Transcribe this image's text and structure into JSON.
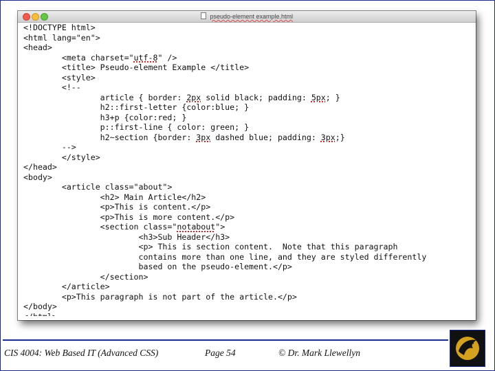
{
  "window": {
    "title": "pseudo-element example.html"
  },
  "code_lines": [
    "<!DOCTYPE html>",
    "<html lang=\"en\">",
    "<head>",
    "        <meta charset=\"utf-8\" />",
    "        <title> Pseudo-element Example </title>",
    "        <style>",
    "        <!--",
    "                article { border: 2px solid black; padding: 5px; }",
    "                h2::first-letter {color:blue; }",
    "                h3+p {color:red; }",
    "                p::first-line { color: green; }",
    "                h2~section {border: 3px dashed blue; padding: 3px;}",
    "        -->",
    "        </style>",
    "</head>",
    "<body>",
    "        <article class=\"about\">",
    "                <h2> Main Article</h2>",
    "                <p>This is content.</p>",
    "                <p>This is more content.</p>",
    "                <section class=\"notabout\">",
    "                        <h3>Sub Header</h3>",
    "                        <p> This is section content.  Note that this paragraph",
    "                        contains more than one line, and they are styled differently",
    "                        based on the pseudo-element.</p>",
    "                </section>",
    "        </article>",
    "        <p>This paragraph is not part of the article.</p>",
    "</body>",
    "</html>"
  ],
  "footer": {
    "course": "CIS 4004: Web Based IT (Advanced CSS)",
    "page": "Page 54",
    "author": "© Dr. Mark Llewellyn"
  },
  "colors": {
    "accent": "#1a2a8a",
    "logo_gold": "#d4a020"
  },
  "icons": {
    "close": "close-icon",
    "minimize": "minimize-icon",
    "zoom": "zoom-icon",
    "document": "document-icon",
    "logo": "ucf-pegasus-logo-icon"
  }
}
